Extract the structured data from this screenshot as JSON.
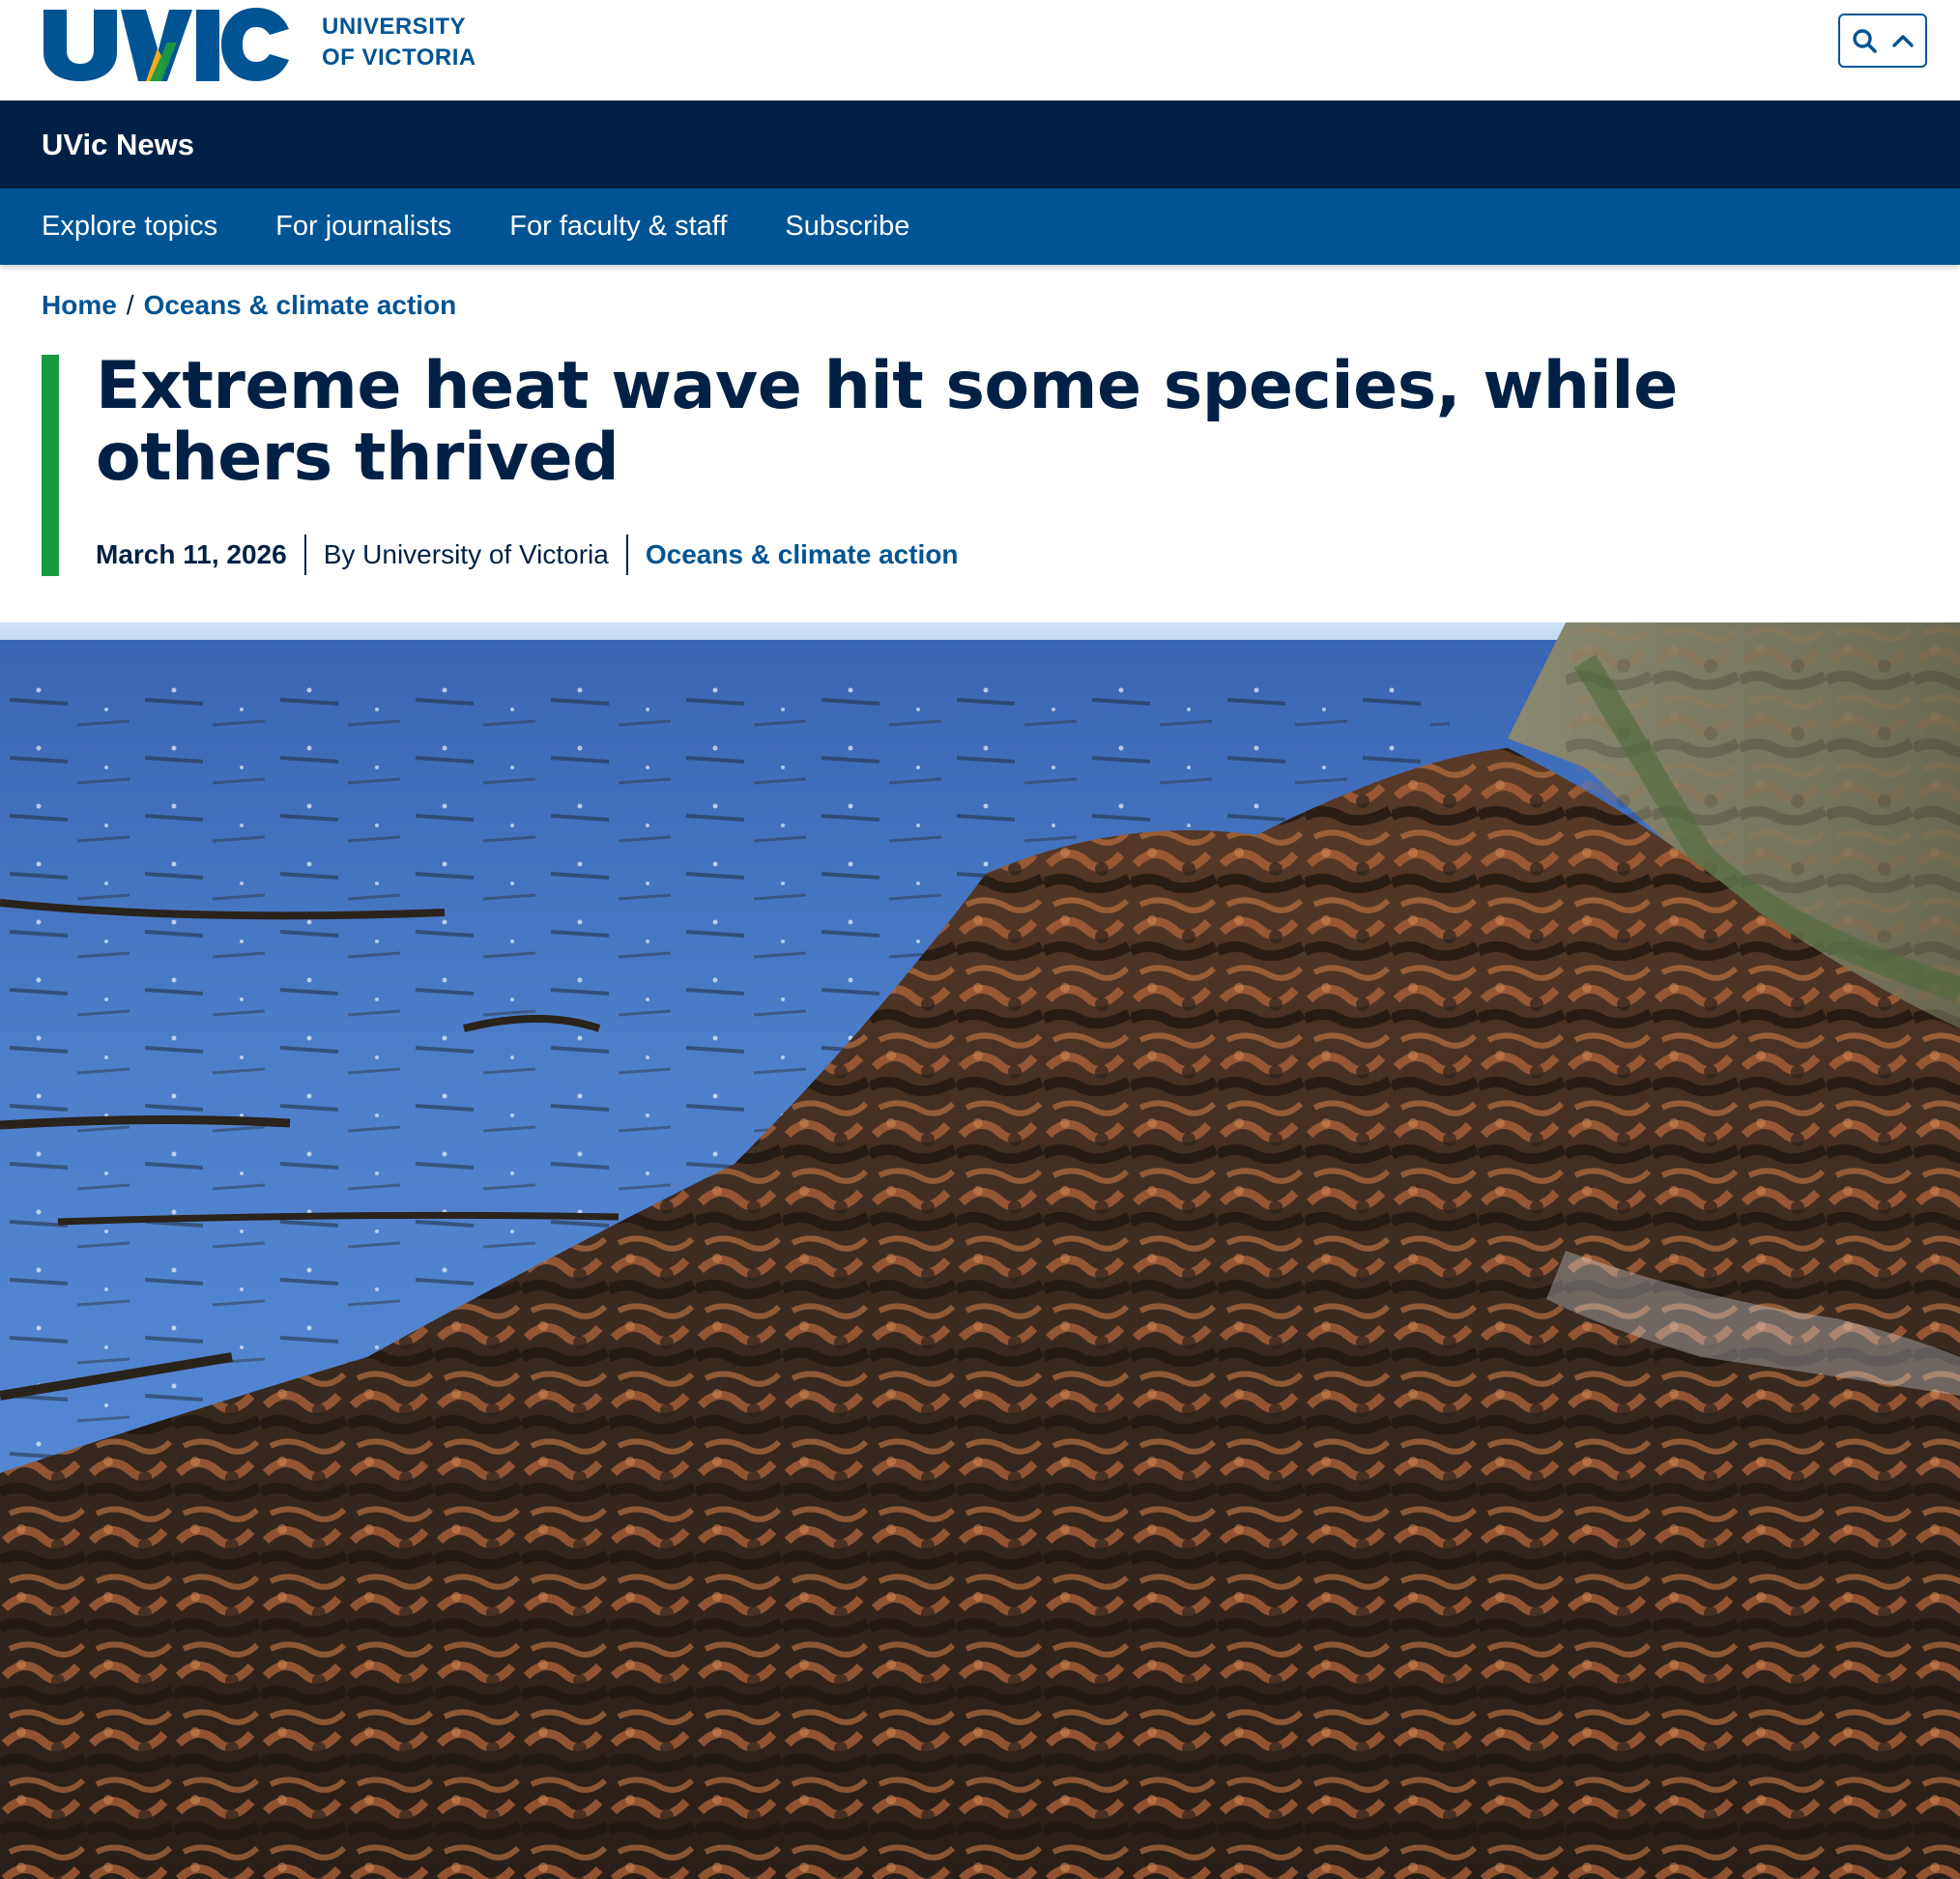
{
  "header": {
    "logo_text": "UVIC",
    "wordmark_line1": "UNIVERSITY",
    "wordmark_line2": "OF VICTORIA",
    "icons": [
      "search-icon",
      "chevron-up-icon"
    ]
  },
  "site": {
    "title": "UVic News"
  },
  "nav": {
    "items": [
      {
        "label": "Explore topics"
      },
      {
        "label": "For journalists"
      },
      {
        "label": "For faculty & staff"
      },
      {
        "label": "Subscribe"
      }
    ]
  },
  "breadcrumb": {
    "home": "Home",
    "separator": "/",
    "current": "Oceans & climate action"
  },
  "article": {
    "title": "Extreme heat wave hit some species, while others thrived",
    "date": "March 11, 2026",
    "author": "By University of Victoria",
    "topic": "Oceans & climate action"
  },
  "colors": {
    "navy": "#002145",
    "blue": "#005493",
    "green": "#1a9a40",
    "gold": "#f5aa1c"
  }
}
